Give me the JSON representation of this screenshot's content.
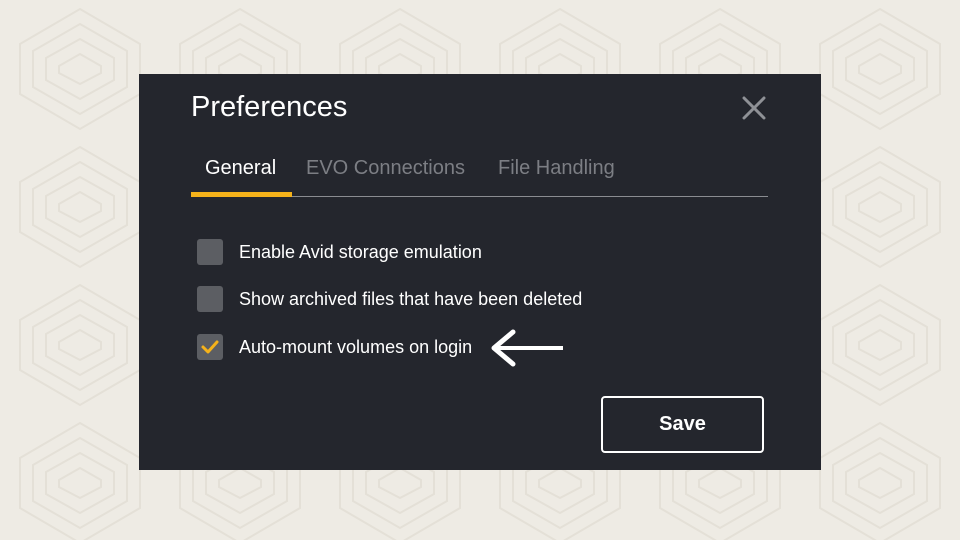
{
  "dialog": {
    "title": "Preferences",
    "close_icon": "close-icon",
    "background_color": "#24262d",
    "accent_color": "#f5b21a"
  },
  "tabs": [
    {
      "label": "General",
      "active": true
    },
    {
      "label": "EVO Connections",
      "active": false
    },
    {
      "label": "File Handling",
      "active": false
    }
  ],
  "options": [
    {
      "label": "Enable Avid storage emulation",
      "checked": false
    },
    {
      "label": "Show archived files that have been deleted",
      "checked": false
    },
    {
      "label": "Auto-mount volumes on login",
      "checked": true
    }
  ],
  "annotation": {
    "icon": "left-arrow-icon",
    "color": "#ffffff"
  },
  "actions": {
    "save_label": "Save"
  }
}
